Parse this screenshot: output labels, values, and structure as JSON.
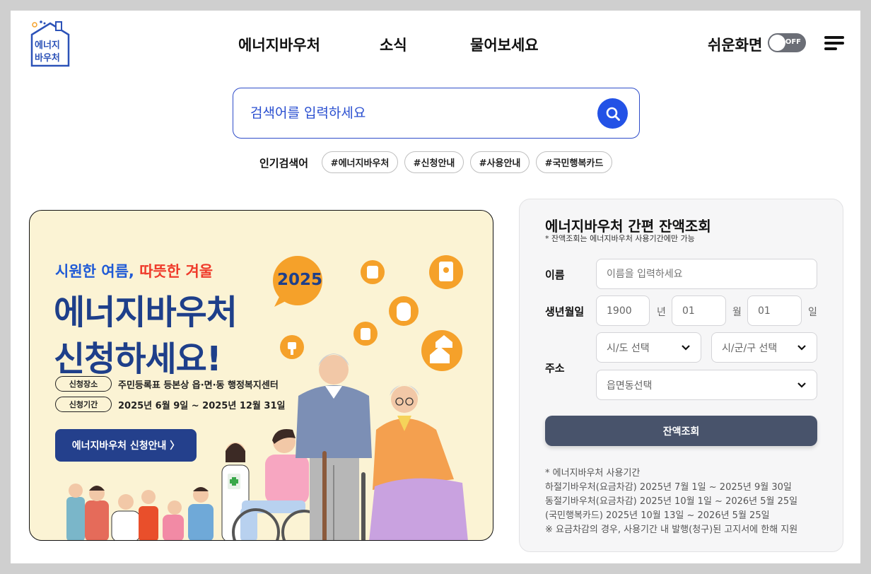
{
  "header": {
    "logo_text_1": "에너지",
    "logo_text_2": "바우처",
    "nav": [
      "에너지바우처",
      "소식",
      "물어보세요"
    ],
    "easy_mode_label": "쉬운화면",
    "toggle_state": "OFF"
  },
  "search": {
    "placeholder": "검색어를 입력하세요",
    "popular_label": "인기검색어",
    "tags": [
      "#에너지바우처",
      "#신청안내",
      "#사용안내",
      "#국민행복카드"
    ]
  },
  "banner": {
    "sub_a": "시원한 여름,",
    "sub_b": "따뜻한 겨울",
    "title_1": "에너지바우처",
    "title_2": "신청하세요!",
    "year": "2025",
    "place_label": "신청장소",
    "place_text": "주민등록표 등본상 읍·면·동 행정복지센터",
    "period_label": "신청기간",
    "period_text": "2025년 6월 9일 ~ 2025년 12월 31일",
    "button": "에너지바우처 신청안내 〉"
  },
  "balance": {
    "title": "에너지바우처 간편 잔액조회",
    "note": "* 잔액조회는 에너지바우처 사용기간에만 가능",
    "name_label": "이름",
    "name_placeholder": "이름을 입력하세요",
    "birth_label": "생년월일",
    "birth_year": "1900",
    "birth_month": "01",
    "birth_day": "01",
    "unit_year": "년",
    "unit_month": "월",
    "unit_day": "일",
    "address_label": "주소",
    "sido": "시/도 선택",
    "sigungu": "시/군/구 선택",
    "eupmyeondong": "읍면동선택",
    "submit": "잔액조회",
    "periods": [
      "* 에너지바우처 사용기간",
      "하절기바우처(요금차감) 2025년 7월 1일 ~ 2025년 9월 30일",
      "동절기바우처(요금차감) 2025년 10월 1일 ~ 2026년 5월 25일",
      "(국민행복카드) 2025년 10월 13일 ~ 2026년 5월 25일",
      "※ 요금차감의 경우, 사용기간 내 발행(청구)된 고지서에 한해 지원"
    ]
  },
  "colors": {
    "primary_blue": "#2352e6",
    "banner_bg": "#fbf3d4",
    "banner_title": "#1e3f8a",
    "accent_orange": "#f5a12a",
    "submit_bg": "#48536b"
  }
}
